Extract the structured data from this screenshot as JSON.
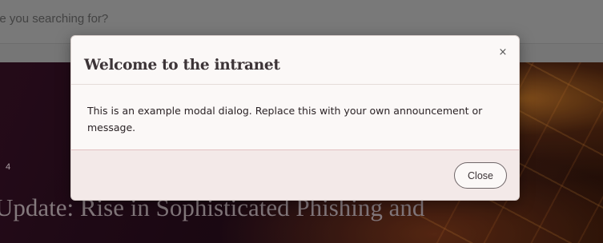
{
  "search": {
    "partial_text": "are you searching for?"
  },
  "hero": {
    "tag": "4",
    "title": "Update: Rise in Sophisticated Phishing and"
  },
  "modal": {
    "title": "Welcome to the intranet",
    "close_icon": "×",
    "body_text": "This is an example modal dialog. Replace this with your own announcement or message.",
    "close_button_label": "Close"
  },
  "colors": {
    "modal_background": "#fbf8f7",
    "modal_footer": "#f3e9e8",
    "body_divider": "#e2bfc0",
    "hero_background": "#200a17"
  }
}
